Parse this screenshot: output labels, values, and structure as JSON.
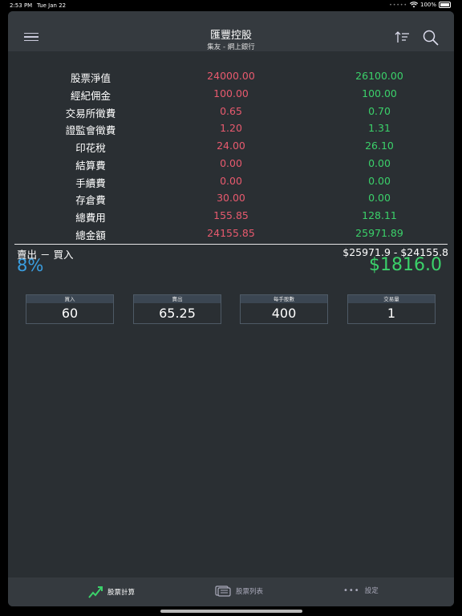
{
  "status_bar": {
    "time": "2:53 PM",
    "date": "Tue Jan 22",
    "battery": "100%"
  },
  "nav": {
    "title": "匯豐控股",
    "subtitle": "集友 - 網上銀行"
  },
  "fees": [
    {
      "label": "股票淨值",
      "buy": "24000.00",
      "sell": "26100.00"
    },
    {
      "label": "經紀佣金",
      "buy": "100.00",
      "sell": "100.00"
    },
    {
      "label": "交易所徵費",
      "buy": "0.65",
      "sell": "0.70"
    },
    {
      "label": "證監會徵費",
      "buy": "1.20",
      "sell": "1.31"
    },
    {
      "label": "印花稅",
      "buy": "24.00",
      "sell": "26.10"
    },
    {
      "label": "結算費",
      "buy": "0.00",
      "sell": "0.00"
    },
    {
      "label": "手續費",
      "buy": "0.00",
      "sell": "0.00"
    },
    {
      "label": "存倉費",
      "buy": "30.00",
      "sell": "0.00"
    },
    {
      "label": "總費用",
      "buy": "155.85",
      "sell": "128.11"
    },
    {
      "label": "總金額",
      "buy": "24155.85",
      "sell": "25971.89"
    }
  ],
  "summary": {
    "label": "賣出 － 買入",
    "equation": "$25971.9 - $24155.8",
    "percent": "8%",
    "difference": "$1816.0"
  },
  "inputs": [
    {
      "label": "買入",
      "value": "60"
    },
    {
      "label": "賣出",
      "value": "65.25"
    },
    {
      "label": "每手股數",
      "value": "400"
    },
    {
      "label": "交易量",
      "value": "1"
    }
  ],
  "tabs": [
    {
      "label": "股票計算"
    },
    {
      "label": "股票列表"
    },
    {
      "label": "設定"
    }
  ],
  "colors": {
    "buy": "#e85a6e",
    "sell": "#3bd16a",
    "percent": "#3a9ee0",
    "background": "#2a2f33"
  }
}
